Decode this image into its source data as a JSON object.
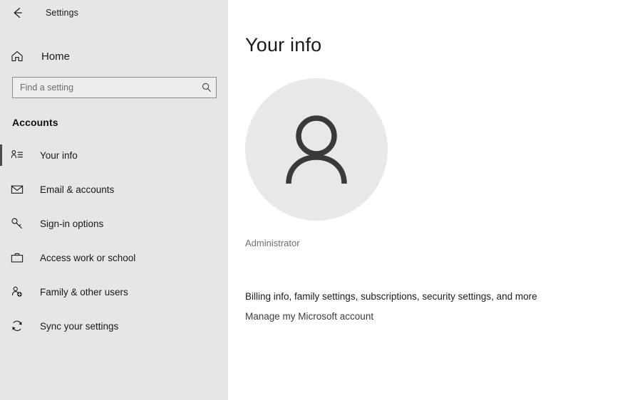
{
  "window": {
    "title": "Settings",
    "back_icon": "back-arrow-icon"
  },
  "sidebar": {
    "home": {
      "label": "Home",
      "icon": "home-icon"
    },
    "search": {
      "placeholder": "Find a setting",
      "value": "",
      "icon": "search-icon"
    },
    "section_heading": "Accounts",
    "items": [
      {
        "label": "Your info",
        "icon": "contact-card-icon",
        "selected": true
      },
      {
        "label": "Email & accounts",
        "icon": "envelope-icon",
        "selected": false
      },
      {
        "label": "Sign-in options",
        "icon": "key-icon",
        "selected": false
      },
      {
        "label": "Access work or school",
        "icon": "briefcase-icon",
        "selected": false
      },
      {
        "label": "Family & other users",
        "icon": "person-add-icon",
        "selected": false
      },
      {
        "label": "Sync your settings",
        "icon": "sync-icon",
        "selected": false
      }
    ]
  },
  "main": {
    "page_title": "Your info",
    "avatar_icon": "person-avatar-icon",
    "account_name": "Administrator",
    "billing_text": "Billing info, family settings, subscriptions, security settings, and more",
    "manage_account_link": "Manage my Microsoft account"
  },
  "colors": {
    "sidebar_background": "#e6e6e6",
    "main_background": "#ffffff",
    "selection_bar": "#4c4c4c",
    "avatar_background": "#e8e8e8",
    "text_primary": "#1a1a1a",
    "text_secondary": "#707070"
  }
}
